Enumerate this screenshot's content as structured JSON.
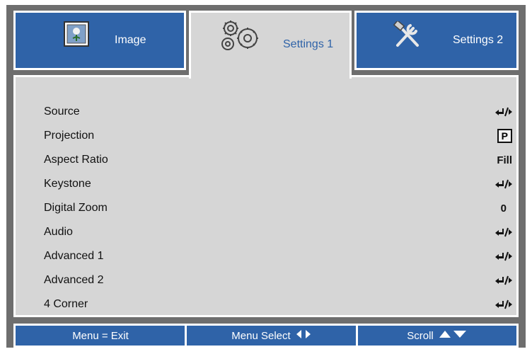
{
  "tabs": [
    {
      "label": "Image",
      "icon": "image-icon",
      "active": false
    },
    {
      "label": "Settings 1",
      "icon": "gears-icon",
      "active": true
    },
    {
      "label": "Settings 2",
      "icon": "tools-icon",
      "active": false
    }
  ],
  "menu": {
    "items": [
      {
        "label": "Source",
        "value_icon": "enter-arrow-icon"
      },
      {
        "label": "Projection",
        "value": "P"
      },
      {
        "label": "Aspect Ratio",
        "value": "Fill"
      },
      {
        "label": "Keystone",
        "value_icon": "enter-arrow-icon"
      },
      {
        "label": "Digital Zoom",
        "value": "0"
      },
      {
        "label": "Audio",
        "value_icon": "enter-arrow-icon"
      },
      {
        "label": "Advanced 1",
        "value_icon": "enter-arrow-icon"
      },
      {
        "label": "Advanced 2",
        "value_icon": "enter-arrow-icon"
      },
      {
        "label": "4 Corner",
        "value_icon": "enter-arrow-icon"
      }
    ]
  },
  "footer": {
    "exit": "Menu = Exit",
    "select": "Menu Select",
    "scroll": "Scroll"
  },
  "colors": {
    "accent": "#2f63a8",
    "panel": "#d6d6d6",
    "frame": "#6e6e6e"
  }
}
